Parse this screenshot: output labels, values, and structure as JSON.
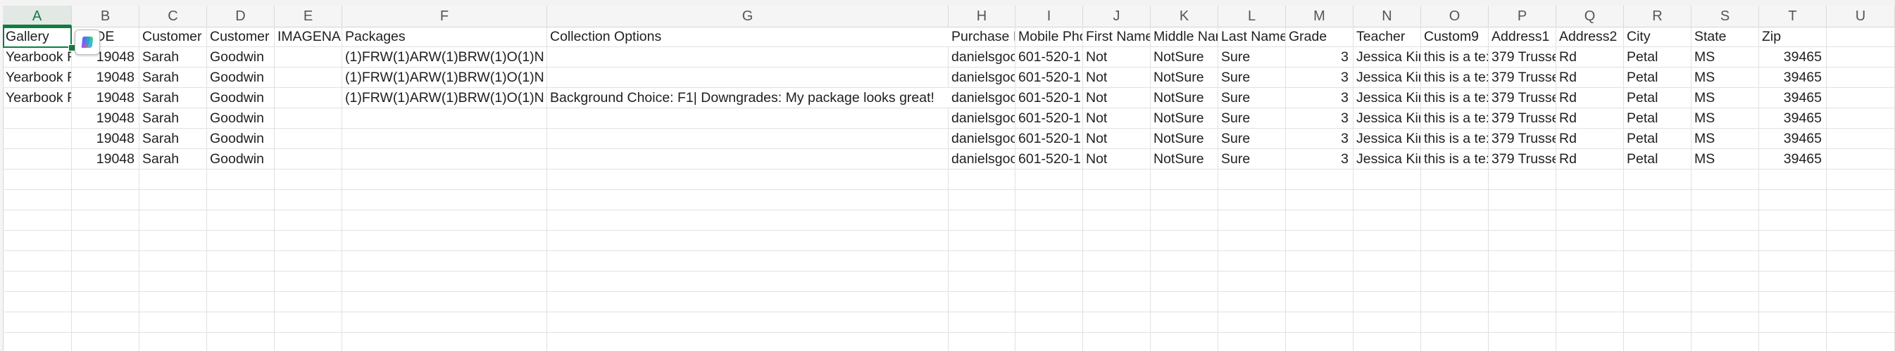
{
  "columns": [
    "A",
    "B",
    "C",
    "D",
    "E",
    "F",
    "G",
    "H",
    "I",
    "J",
    "K",
    "L",
    "M",
    "N",
    "O",
    "P",
    "Q",
    "R",
    "S",
    "T",
    "U"
  ],
  "selected_column": "A",
  "copilot_icon": "copilot-icon",
  "accent_color": "#107c41",
  "header_row": {
    "A": "Gallery",
    "B": "ORDE",
    "C": "Customer",
    "D": "Customer",
    "E": "IMAGENAN",
    "F": "Packages",
    "G": "Collection Options",
    "H": "Purchase I",
    "I": "Mobile Pho",
    "J": "First Name",
    "K": "Middle Nar",
    "L": "Last Name",
    "M": "Grade",
    "N": "Teacher",
    "O": "Custom9",
    "P": "Address1",
    "Q": "Address2",
    "R": "City",
    "S": "State",
    "T": "Zip",
    "U": ""
  },
  "rows": [
    {
      "A": "Yearbook F",
      "B": "19048",
      "C": "Sarah",
      "D": "Goodwin",
      "E": "",
      "F": "(1)FRW(1)ARW(1)BRW(1)O(1)N",
      "G": "",
      "H": "danielsgoc",
      "I": "601-520-1",
      "J": "Not",
      "K": "NotSure",
      "L": "Sure",
      "M": "3",
      "N": "Jessica Kir",
      "O": "this is a te:",
      "P": "379 Trussel",
      "Q": "Rd",
      "R": "Petal",
      "S": "MS",
      "T": "39465",
      "U": ""
    },
    {
      "A": "Yearbook F",
      "B": "19048",
      "C": "Sarah",
      "D": "Goodwin",
      "E": "",
      "F": "(1)FRW(1)ARW(1)BRW(1)O(1)N",
      "G": "",
      "H": "danielsgoc",
      "I": "601-520-1",
      "J": "Not",
      "K": "NotSure",
      "L": "Sure",
      "M": "3",
      "N": "Jessica Kir",
      "O": "this is a te:",
      "P": "379 Trussel",
      "Q": "Rd",
      "R": "Petal",
      "S": "MS",
      "T": "39465",
      "U": ""
    },
    {
      "A": "Yearbook F",
      "B": "19048",
      "C": "Sarah",
      "D": "Goodwin",
      "E": "",
      "F": "(1)FRW(1)ARW(1)BRW(1)O(1)N",
      "G": "Background Choice: F1| Downgrades: My package looks great!",
      "H": "danielsgoc",
      "I": "601-520-1",
      "J": "Not",
      "K": "NotSure",
      "L": "Sure",
      "M": "3",
      "N": "Jessica Kir",
      "O": "this is a te:",
      "P": "379 Trussel",
      "Q": "Rd",
      "R": "Petal",
      "S": "MS",
      "T": "39465",
      "U": ""
    },
    {
      "A": "",
      "B": "19048",
      "C": "Sarah",
      "D": "Goodwin",
      "E": "",
      "F": "",
      "G": "",
      "H": "danielsgoc",
      "I": "601-520-1",
      "J": "Not",
      "K": "NotSure",
      "L": "Sure",
      "M": "3",
      "N": "Jessica Kir",
      "O": "this is a te:",
      "P": "379 Trussel",
      "Q": "Rd",
      "R": "Petal",
      "S": "MS",
      "T": "39465",
      "U": ""
    },
    {
      "A": "",
      "B": "19048",
      "C": "Sarah",
      "D": "Goodwin",
      "E": "",
      "F": "",
      "G": "",
      "H": "danielsgoc",
      "I": "601-520-1",
      "J": "Not",
      "K": "NotSure",
      "L": "Sure",
      "M": "3",
      "N": "Jessica Kir",
      "O": "this is a te:",
      "P": "379 Trussel",
      "Q": "Rd",
      "R": "Petal",
      "S": "MS",
      "T": "39465",
      "U": ""
    },
    {
      "A": "",
      "B": "19048",
      "C": "Sarah",
      "D": "Goodwin",
      "E": "",
      "F": "",
      "G": "",
      "H": "danielsgoc",
      "I": "601-520-1",
      "J": "Not",
      "K": "NotSure",
      "L": "Sure",
      "M": "3",
      "N": "Jessica Kir",
      "O": "this is a te:",
      "P": "379 Trussel",
      "Q": "Rd",
      "R": "Petal",
      "S": "MS",
      "T": "39465",
      "U": ""
    }
  ],
  "empty_row_count": 9
}
